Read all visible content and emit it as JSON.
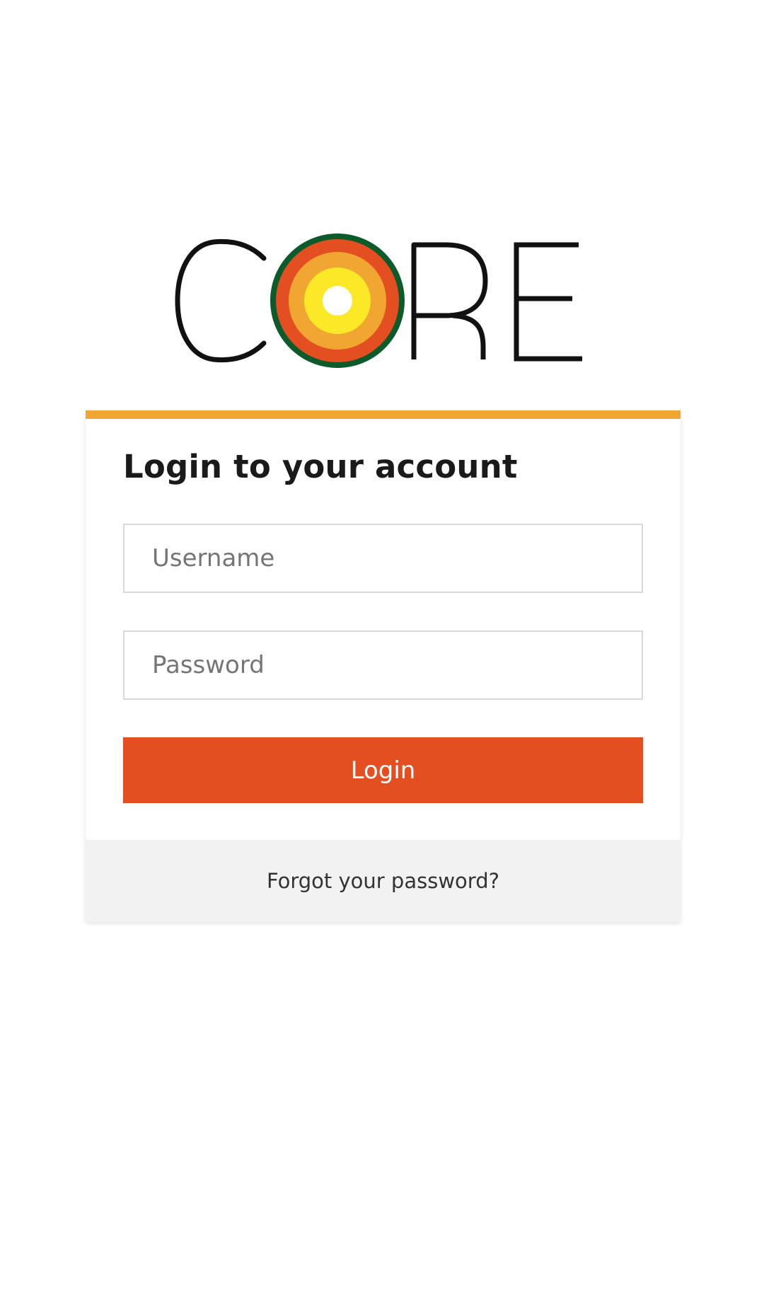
{
  "logo": {
    "text": "CORE",
    "letters": [
      "C",
      "R",
      "E"
    ],
    "ring_colors": [
      "#0d5a2b",
      "#e44f22",
      "#f0a630",
      "#fbe928",
      "#ffffff"
    ]
  },
  "login_card": {
    "accent_color": "#f0a630",
    "title": "Login to your account",
    "username": {
      "placeholder": "Username",
      "value": ""
    },
    "password": {
      "placeholder": "Password",
      "value": ""
    },
    "login_button": {
      "label": "Login",
      "color": "#e44f22"
    },
    "forgot_password_link": "Forgot your password?"
  }
}
